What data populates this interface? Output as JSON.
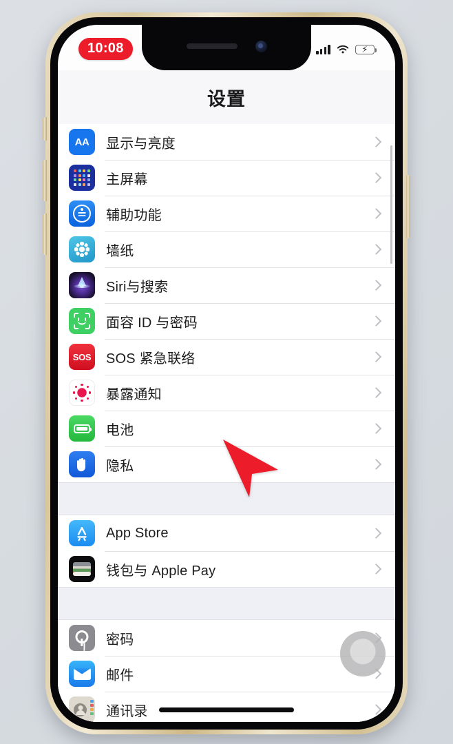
{
  "device": {
    "name": "iPhone 12",
    "frame_color": "#ddc99e",
    "bezel_color": "#07070a"
  },
  "status_bar": {
    "time": "10:08",
    "recording_pill_color": "#ec1c2a",
    "icons": [
      "cellular-signal-icon",
      "wifi-icon",
      "battery-charging-icon"
    ],
    "signal_bars": 4,
    "battery_charging": true
  },
  "nav": {
    "title": "设置"
  },
  "list": {
    "groups": [
      {
        "id": "group-system",
        "rows": [
          {
            "label": "显示与亮度",
            "icon": "display-brightness-icon",
            "color": "#1775ee"
          },
          {
            "label": "主屏幕",
            "icon": "home-screen-icon",
            "color": "#1b2f9e"
          },
          {
            "label": "辅助功能",
            "icon": "accessibility-icon",
            "color": "#1a7ae8"
          },
          {
            "label": "墙纸",
            "icon": "wallpaper-icon",
            "color": "#3fb6dc"
          },
          {
            "label": "Siri与搜索",
            "icon": "siri-search-icon",
            "color": "#2b1b4d"
          },
          {
            "label": "面容 ID 与密码",
            "icon": "face-id-icon",
            "color": "#3ed063"
          },
          {
            "label": "SOS 紧急联络",
            "icon": "emergency-sos-icon",
            "color": "#e01f2c"
          },
          {
            "label": "暴露通知",
            "icon": "exposure-notification-icon",
            "color": "#e8154f"
          },
          {
            "label": "电池",
            "icon": "battery-icon",
            "color": "#34c94b"
          },
          {
            "label": "隐私",
            "icon": "privacy-hand-icon",
            "color": "#1f6fe6"
          }
        ]
      },
      {
        "id": "group-store",
        "rows": [
          {
            "label": "App Store",
            "icon": "app-store-icon",
            "color": "#2b9df4"
          },
          {
            "label": "钱包与 Apple Pay",
            "icon": "wallet-apple-pay-icon",
            "color": "#0c0c0e"
          }
        ]
      },
      {
        "id": "group-accounts",
        "rows": [
          {
            "label": "密码",
            "icon": "passwords-key-icon",
            "color": "#8b8b90"
          },
          {
            "label": "邮件",
            "icon": "mail-icon",
            "color": "#1f8bf0"
          },
          {
            "label": "通讯录",
            "icon": "contacts-icon",
            "color": "#ded9cf"
          }
        ]
      }
    ],
    "disclosure_icon": "chevron-right-icon"
  },
  "overlays": {
    "assistive_touch": "assistive-touch-button",
    "cursor": "mouse-cursor-arrow",
    "cursor_color": "#ec1c2a",
    "home_indicator": "home-indicator-bar",
    "scrollbar": "list-scrollbar"
  }
}
